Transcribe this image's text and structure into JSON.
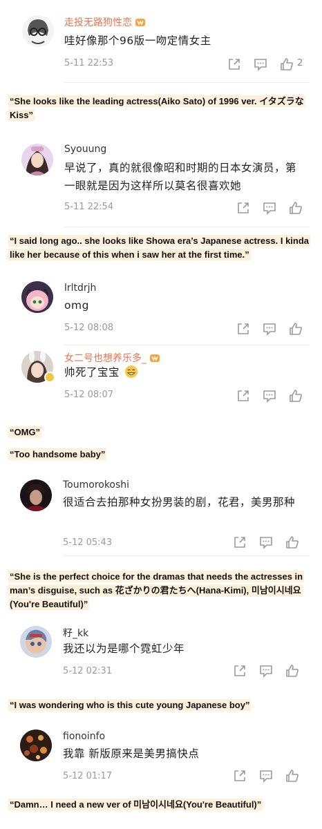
{
  "comments": [
    {
      "user": "走投无路狗性恋",
      "text": "哇好像那个96版一吻定情女主",
      "time": "5-11 22:53",
      "likes": "2"
    },
    {
      "user": "Syouung",
      "text": "早说了，真的就很像昭和时期的日本女演员，第一眼就是因为这样所以莫名很喜欢她",
      "time": "5-11 22:54"
    },
    {
      "user": "lrltdrjh",
      "text": "omg",
      "time": "5-12 08:08"
    },
    {
      "user": "女二号也想养乐多_",
      "text": "帅死了宝宝",
      "time": "5-12 08:07"
    },
    {
      "user": "Toumorokoshi",
      "text": "很适合去拍那种女扮男装的剧，花君，美男那种",
      "time": "5-12 05:43"
    },
    {
      "user": "籽_kk",
      "text": "我还以为是哪个霓虹少年",
      "time": "5-12 02:31"
    },
    {
      "user": "fionoinfo",
      "text": "我靠 新版原来是美男搞快点",
      "time": "5-12 01:17"
    }
  ],
  "translations": {
    "t1": "“She looks like the leading actress(Aiko Sato) of 1996 ver. イタズラなKiss”",
    "t2": "“I said long ago.. she looks like Showa era’s Japanese actress. I kinda like her because of this when i saw her at the first time.”",
    "t3": "“OMG”",
    "t4": "“Too handsome baby”",
    "t5": "“She is the perfect choice for the dramas that needs the actresses in man’s disguise, such as 花ざかりの君たちへ(Hana-Kimi), 미남이시네요(You're Beautiful)”",
    "t6": "“I was wondering who is this cute young Japanese boy”",
    "t7": "“Damn… I need a new ver of 미남이시네요(You're Beautiful)”"
  },
  "colors": {
    "orange_username": "#eb7350",
    "highlight": "#fdf1dc",
    "icon_gray": "#9a9a9a",
    "emoji": "#f7c84a"
  },
  "icons": [
    "share-icon",
    "comment-icon",
    "like-icon",
    "vip-badge-icon",
    "grin-emoji-icon"
  ]
}
